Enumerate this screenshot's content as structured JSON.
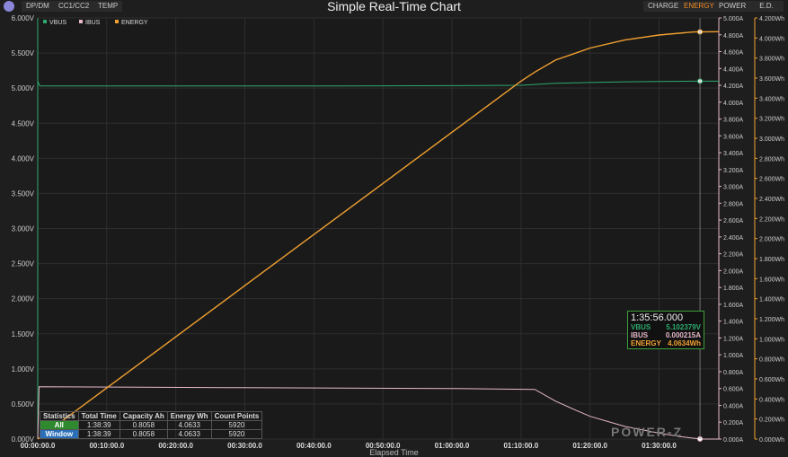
{
  "header": {
    "title": "Simple Real-Time Chart",
    "tabs_left": [
      "DP/DM",
      "CC1/CC2",
      "TEMP"
    ],
    "tabs_right": [
      "CHARGE",
      "ENERGY",
      "POWER",
      "E.D."
    ],
    "active_right": "ENERGY"
  },
  "colors": {
    "vbus": "#2eaa6e",
    "ibus": "#e7b9c9",
    "energy": "#f0a030",
    "accent": "#f08a24"
  },
  "legend": [
    "VBUS",
    "IBUS",
    "ENERGY"
  ],
  "chart_data": {
    "type": "line",
    "title": "Simple Real-Time Chart",
    "xlabel": "Elapsed Time",
    "x_unit": "minutes",
    "xlim": [
      0,
      99
    ],
    "x_ticks": [
      "00:00:00.0",
      "00:10:00.0",
      "00:20:00.0",
      "00:30:00.0",
      "00:40:00.0",
      "00:50:00.0",
      "01:00:00.0",
      "01:10:00.0",
      "01:20:00.0",
      "01:30:00.0"
    ],
    "axes": {
      "voltage": {
        "ylim": [
          0,
          6
        ],
        "step": 0.5,
        "unit": "V",
        "decimals": 3
      },
      "current": {
        "ylim": [
          0,
          5
        ],
        "step": 0.2,
        "unit": "A",
        "decimals": 3
      },
      "energy": {
        "ylim": [
          0,
          4.2
        ],
        "step": 0.2,
        "unit": "Wh",
        "decimals": 3
      }
    },
    "series": [
      {
        "name": "VBUS",
        "axis": "voltage",
        "x": [
          0,
          0.3,
          20,
          40,
          60,
          70,
          75,
          80,
          85,
          90,
          95,
          98.65
        ],
        "y": [
          5.1,
          5.03,
          5.03,
          5.03,
          5.035,
          5.04,
          5.07,
          5.08,
          5.09,
          5.095,
          5.1,
          5.1
        ]
      },
      {
        "name": "IBUS",
        "axis": "current",
        "x": [
          0,
          0.2,
          30,
          60,
          72,
          75,
          78,
          80,
          85,
          90,
          93,
          96,
          98.65
        ],
        "y": [
          0,
          0.62,
          0.61,
          0.6,
          0.59,
          0.45,
          0.34,
          0.27,
          0.15,
          0.07,
          0.03,
          0.0002,
          0.0002
        ]
      },
      {
        "name": "ENERGY",
        "axis": "energy",
        "x": [
          0,
          10,
          20,
          30,
          40,
          50,
          60,
          70,
          72,
          75,
          80,
          85,
          90,
          95,
          98.65
        ],
        "y": [
          0,
          0.51,
          1.02,
          1.53,
          2.04,
          2.55,
          3.06,
          3.57,
          3.66,
          3.78,
          3.9,
          3.98,
          4.03,
          4.06,
          4.063
        ]
      }
    ],
    "cursor_x": 95.93
  },
  "tooltip": {
    "time": "1:35:56.000",
    "rows": [
      {
        "label": "VBUS",
        "value": "5.102379V"
      },
      {
        "label": "IBUS",
        "value": "0.000215A"
      },
      {
        "label": "ENERGY",
        "value": "4.0634Wh"
      }
    ]
  },
  "stats": {
    "headers": [
      "Statistics",
      "Total Time",
      "Capacity Ah",
      "Energy Wh",
      "Count Points"
    ],
    "rows": [
      {
        "label": "All",
        "cells": [
          "1:38:39",
          "0.8058",
          "4.0633",
          "5920"
        ]
      },
      {
        "label": "Window",
        "cells": [
          "1:38:39",
          "0.8058",
          "4.0633",
          "5920"
        ]
      }
    ]
  },
  "watermark": "POWER-Z"
}
